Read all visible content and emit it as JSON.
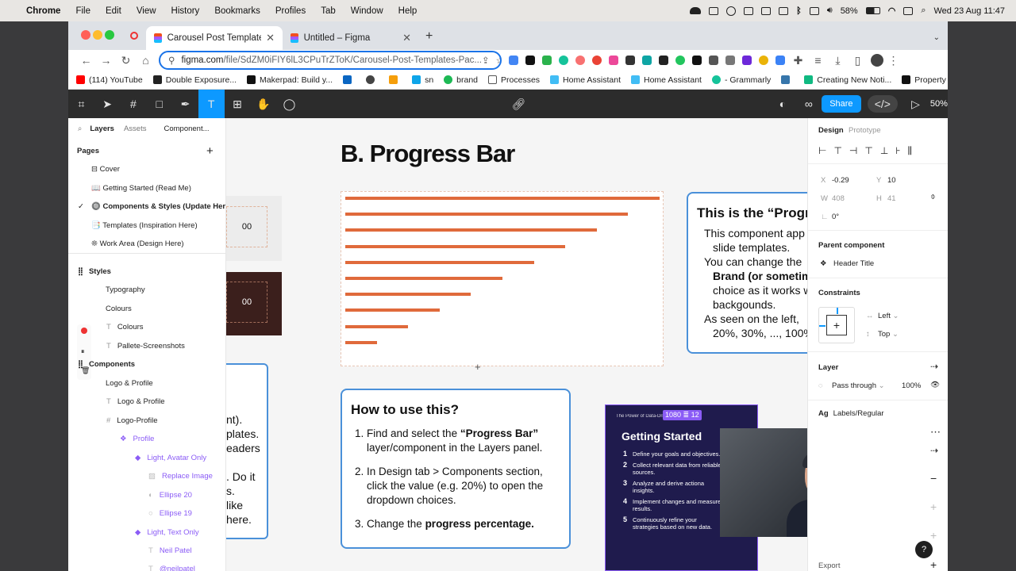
{
  "macbar": {
    "app": "Chrome",
    "menus": [
      "File",
      "Edit",
      "View",
      "History",
      "Bookmarks",
      "Profiles",
      "Tab",
      "Window",
      "Help"
    ],
    "battery": "58%",
    "datetime": "Wed 23 Aug  11:47"
  },
  "tabs": [
    {
      "title": "Carousel Post Templates Pack",
      "active": true
    },
    {
      "title": "Untitled – Figma",
      "active": false
    }
  ],
  "url": {
    "domain": "figma.com",
    "path": "/file/SdZM0iFIY6lL3CPuTrZToK/Carousel-Post-Templates-Pac..."
  },
  "bookmarks": [
    "(114) YouTube",
    "Double Exposure...",
    "Makerpad: Build y...",
    "",
    "",
    "sn",
    "brand",
    "Processes",
    "Home Assistant",
    "Home Assistant",
    "- Grammarly",
    "",
    "Creating New Noti...",
    "Property values"
  ],
  "toolbar": {
    "share": "Share",
    "zoom": "50%"
  },
  "left": {
    "tabs": [
      "Layers",
      "Assets",
      "Component..."
    ],
    "pages_title": "Pages",
    "pages": [
      "⊟ Cover",
      "📖 Getting Started (Read Me)",
      "🔘 Components & Styles (Update Here)",
      "📑 Templates (Inspiration Here)",
      "❊ Work Area (Design Here)"
    ],
    "styles_title": "Styles",
    "typography": "Typography",
    "colours_group": "Colours",
    "colours": "Colours",
    "pallete": "Pallete-Screenshots",
    "components_title": "Components",
    "logo_profile_group": "Logo & Profile",
    "logo_profile": "Logo & Profile",
    "logo_profile2": "Logo-Profile",
    "profile": "Profile",
    "light_avatar": "Light, Avatar Only",
    "replace_image": "Replace Image",
    "ellipse20": "Ellipse 20",
    "ellipse19": "Ellipse 19",
    "light_text": "Light, Text Only",
    "neil": "Neil Patel",
    "neil2": "@neilpatel"
  },
  "canvas": {
    "heading": "B. Progress Bar",
    "left_val1": "00",
    "left_val2": "00",
    "left_snippets": [
      "nt).",
      "plates.",
      "eaders",
      ". Do it",
      "s.",
      "like",
      "here."
    ],
    "callout_title": "This is the “Progr",
    "callout_items": [
      "This component app",
      "slide templates.",
      "You can change the",
      "Brand (or sometim",
      "choice as it works w",
      "backgounds.",
      "As seen on the left,",
      "20%, 30%, ..., 100%."
    ],
    "howto_title": "How to use this?",
    "howto_1a": "Find and select the ",
    "howto_1b": "“Progress Bar”",
    "howto_1c": " layer/component in the Layers panel.",
    "howto_2": "In Design tab > Components section, click the value (e.g. 20%) to open the dropdown choices.",
    "howto_3a": "Change the ",
    "howto_3b": "progress percentage.",
    "gs_kicker": "The Power of Data-Driv",
    "gs_dims": "1080",
    "gs_dims2": "12",
    "gs_title": "Getting Started",
    "gs_steps": [
      "Define your goals and objectives.",
      "Collect relevant data from reliable sources.",
      "Analyze and derive actiona insights.",
      "Implement changes and measure results.",
      "Continuously refine your strategies based on new data."
    ]
  },
  "progress": {
    "fractions": [
      1.0,
      0.9,
      0.8,
      0.7,
      0.6,
      0.5,
      0.4,
      0.3,
      0.2,
      0.1
    ],
    "color": "#e06a3b"
  },
  "right": {
    "tabs": [
      "Design",
      "Prototype"
    ],
    "x_label": "X",
    "x": "-0.29",
    "y_label": "Y",
    "y": "10",
    "w_label": "W",
    "w": "408",
    "h_label": "H",
    "h": "41",
    "rot": "0°",
    "parent_title": "Parent component",
    "parent": "Header Title",
    "constraints_title": "Constraints",
    "c_left": "Left",
    "c_top": "Top",
    "layer_title": "Layer",
    "blend": "Pass through",
    "opacity": "100%",
    "text_style": "Labels/Regular",
    "export": "Export"
  }
}
